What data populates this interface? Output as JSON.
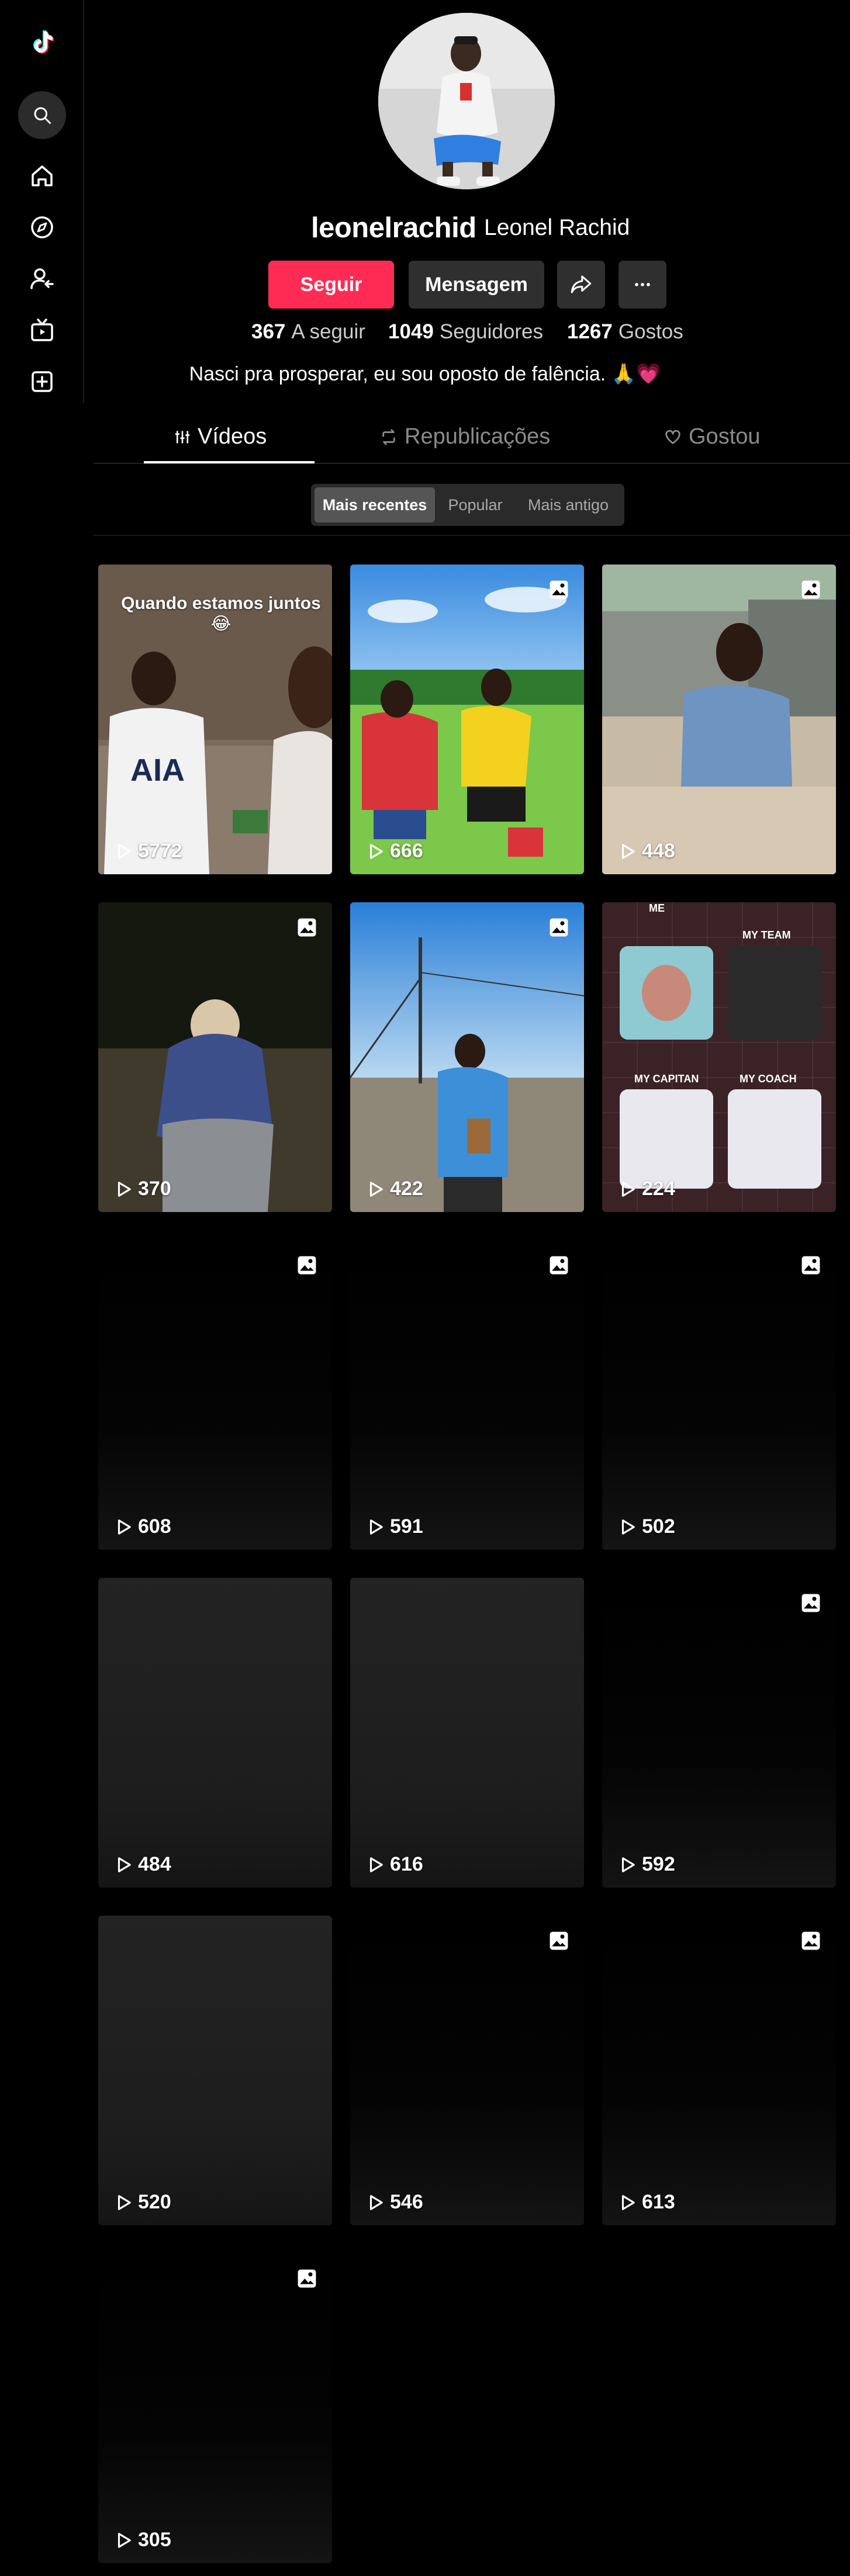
{
  "sidebar": {
    "items": [
      {
        "name": "tiktok-logo"
      },
      {
        "name": "search-icon"
      },
      {
        "name": "home-icon"
      },
      {
        "name": "explore-icon"
      },
      {
        "name": "following-icon"
      },
      {
        "name": "live-icon"
      },
      {
        "name": "upload-icon"
      }
    ]
  },
  "profile": {
    "username": "leonelrachid",
    "nickname": "Leonel Rachid",
    "buttons": {
      "follow": "Seguir",
      "message": "Mensagem"
    },
    "stats": [
      {
        "value": "367",
        "label": "A seguir"
      },
      {
        "value": "1049",
        "label": "Seguidores"
      },
      {
        "value": "1267",
        "label": "Gostos"
      }
    ],
    "bio": "Nasci pra prosperar, eu sou oposto de falência. 🙏💗"
  },
  "tabs": [
    {
      "label": "Vídeos",
      "active": true
    },
    {
      "label": "Republicações",
      "active": false
    },
    {
      "label": "Gostou",
      "active": false
    }
  ],
  "sort": {
    "options": [
      "Mais recentes",
      "Popular",
      "Mais antigo"
    ],
    "selected": "Mais recentes"
  },
  "videos": [
    {
      "views": "5772",
      "caption": "Quando estamos juntos 😂",
      "photo": false
    },
    {
      "views": "666",
      "photo": true
    },
    {
      "views": "448",
      "photo": true
    },
    {
      "views": "370",
      "photo": true
    },
    {
      "views": "422",
      "photo": true
    },
    {
      "views": "224",
      "photo": false,
      "overlay_labels": [
        "ME",
        "MY TEAM",
        "MY CAPITAN",
        "MY COACH"
      ]
    },
    {
      "views": "608",
      "photo": true
    },
    {
      "views": "591",
      "photo": true
    },
    {
      "views": "502",
      "photo": true
    },
    {
      "views": "484",
      "photo": false
    },
    {
      "views": "616",
      "photo": false
    },
    {
      "views": "592",
      "photo": true
    },
    {
      "views": "520",
      "photo": false
    },
    {
      "views": "546",
      "photo": true
    },
    {
      "views": "613",
      "photo": true
    },
    {
      "views": "305",
      "photo": true
    }
  ],
  "colors": {
    "accent": "#fe2c55",
    "background": "#000000",
    "button": "#2f2f2f"
  }
}
